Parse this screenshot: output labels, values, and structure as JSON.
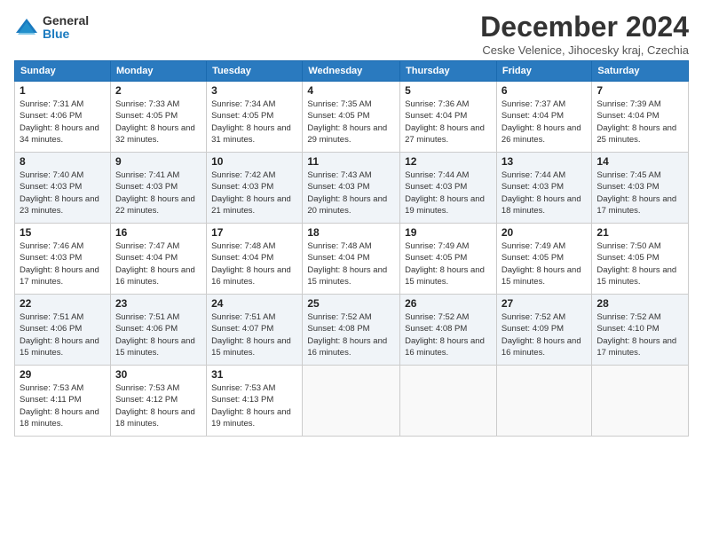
{
  "logo": {
    "general": "General",
    "blue": "Blue"
  },
  "title": "December 2024",
  "location": "Ceske Velenice, Jihocesky kraj, Czechia",
  "weekdays": [
    "Sunday",
    "Monday",
    "Tuesday",
    "Wednesday",
    "Thursday",
    "Friday",
    "Saturday"
  ],
  "weeks": [
    [
      {
        "day": "1",
        "sunrise": "7:31 AM",
        "sunset": "4:06 PM",
        "daylight": "8 hours and 34 minutes."
      },
      {
        "day": "2",
        "sunrise": "7:33 AM",
        "sunset": "4:05 PM",
        "daylight": "8 hours and 32 minutes."
      },
      {
        "day": "3",
        "sunrise": "7:34 AM",
        "sunset": "4:05 PM",
        "daylight": "8 hours and 31 minutes."
      },
      {
        "day": "4",
        "sunrise": "7:35 AM",
        "sunset": "4:05 PM",
        "daylight": "8 hours and 29 minutes."
      },
      {
        "day": "5",
        "sunrise": "7:36 AM",
        "sunset": "4:04 PM",
        "daylight": "8 hours and 27 minutes."
      },
      {
        "day": "6",
        "sunrise": "7:37 AM",
        "sunset": "4:04 PM",
        "daylight": "8 hours and 26 minutes."
      },
      {
        "day": "7",
        "sunrise": "7:39 AM",
        "sunset": "4:04 PM",
        "daylight": "8 hours and 25 minutes."
      }
    ],
    [
      {
        "day": "8",
        "sunrise": "7:40 AM",
        "sunset": "4:03 PM",
        "daylight": "8 hours and 23 minutes."
      },
      {
        "day": "9",
        "sunrise": "7:41 AM",
        "sunset": "4:03 PM",
        "daylight": "8 hours and 22 minutes."
      },
      {
        "day": "10",
        "sunrise": "7:42 AM",
        "sunset": "4:03 PM",
        "daylight": "8 hours and 21 minutes."
      },
      {
        "day": "11",
        "sunrise": "7:43 AM",
        "sunset": "4:03 PM",
        "daylight": "8 hours and 20 minutes."
      },
      {
        "day": "12",
        "sunrise": "7:44 AM",
        "sunset": "4:03 PM",
        "daylight": "8 hours and 19 minutes."
      },
      {
        "day": "13",
        "sunrise": "7:44 AM",
        "sunset": "4:03 PM",
        "daylight": "8 hours and 18 minutes."
      },
      {
        "day": "14",
        "sunrise": "7:45 AM",
        "sunset": "4:03 PM",
        "daylight": "8 hours and 17 minutes."
      }
    ],
    [
      {
        "day": "15",
        "sunrise": "7:46 AM",
        "sunset": "4:03 PM",
        "daylight": "8 hours and 17 minutes."
      },
      {
        "day": "16",
        "sunrise": "7:47 AM",
        "sunset": "4:04 PM",
        "daylight": "8 hours and 16 minutes."
      },
      {
        "day": "17",
        "sunrise": "7:48 AM",
        "sunset": "4:04 PM",
        "daylight": "8 hours and 16 minutes."
      },
      {
        "day": "18",
        "sunrise": "7:48 AM",
        "sunset": "4:04 PM",
        "daylight": "8 hours and 15 minutes."
      },
      {
        "day": "19",
        "sunrise": "7:49 AM",
        "sunset": "4:05 PM",
        "daylight": "8 hours and 15 minutes."
      },
      {
        "day": "20",
        "sunrise": "7:49 AM",
        "sunset": "4:05 PM",
        "daylight": "8 hours and 15 minutes."
      },
      {
        "day": "21",
        "sunrise": "7:50 AM",
        "sunset": "4:05 PM",
        "daylight": "8 hours and 15 minutes."
      }
    ],
    [
      {
        "day": "22",
        "sunrise": "7:51 AM",
        "sunset": "4:06 PM",
        "daylight": "8 hours and 15 minutes."
      },
      {
        "day": "23",
        "sunrise": "7:51 AM",
        "sunset": "4:06 PM",
        "daylight": "8 hours and 15 minutes."
      },
      {
        "day": "24",
        "sunrise": "7:51 AM",
        "sunset": "4:07 PM",
        "daylight": "8 hours and 15 minutes."
      },
      {
        "day": "25",
        "sunrise": "7:52 AM",
        "sunset": "4:08 PM",
        "daylight": "8 hours and 16 minutes."
      },
      {
        "day": "26",
        "sunrise": "7:52 AM",
        "sunset": "4:08 PM",
        "daylight": "8 hours and 16 minutes."
      },
      {
        "day": "27",
        "sunrise": "7:52 AM",
        "sunset": "4:09 PM",
        "daylight": "8 hours and 16 minutes."
      },
      {
        "day": "28",
        "sunrise": "7:52 AM",
        "sunset": "4:10 PM",
        "daylight": "8 hours and 17 minutes."
      }
    ],
    [
      {
        "day": "29",
        "sunrise": "7:53 AM",
        "sunset": "4:11 PM",
        "daylight": "8 hours and 18 minutes."
      },
      {
        "day": "30",
        "sunrise": "7:53 AM",
        "sunset": "4:12 PM",
        "daylight": "8 hours and 18 minutes."
      },
      {
        "day": "31",
        "sunrise": "7:53 AM",
        "sunset": "4:13 PM",
        "daylight": "8 hours and 19 minutes."
      },
      null,
      null,
      null,
      null
    ]
  ]
}
